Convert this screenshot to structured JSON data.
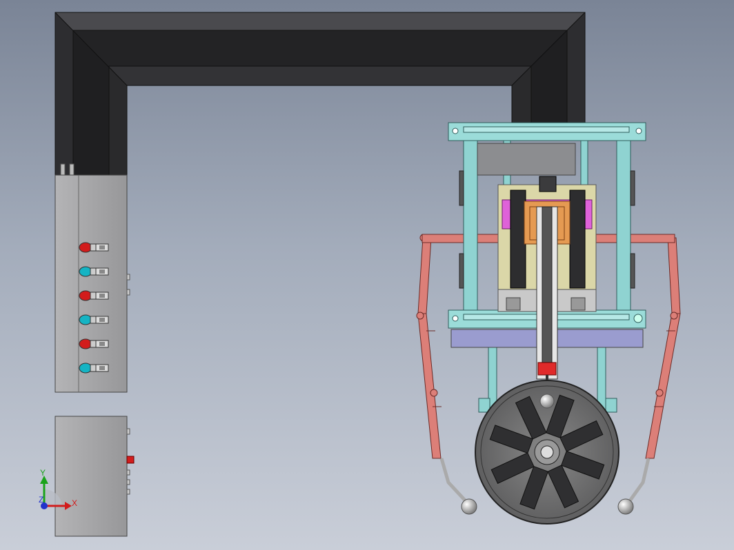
{
  "viewport": {
    "axis_triad": {
      "x_label": "X",
      "y_label": "Y",
      "z_label": "Z"
    }
  },
  "colors": {
    "duct": "#2b2b2e",
    "cabinet": "#a7a7a9",
    "frame": "#8fd3d1",
    "arm": "#dc7f78",
    "carriage": "#dbd7a8",
    "magenta_block": "#df62d9",
    "plate": "#9a9ccf",
    "wheel": "#6c6c6c",
    "blade": "#2f2f31",
    "valve_red": "#d21c1c",
    "valve_cyan": "#14b4c4"
  },
  "cabinet_valves": [
    "red",
    "cyan",
    "red",
    "cyan",
    "red",
    "cyan"
  ]
}
